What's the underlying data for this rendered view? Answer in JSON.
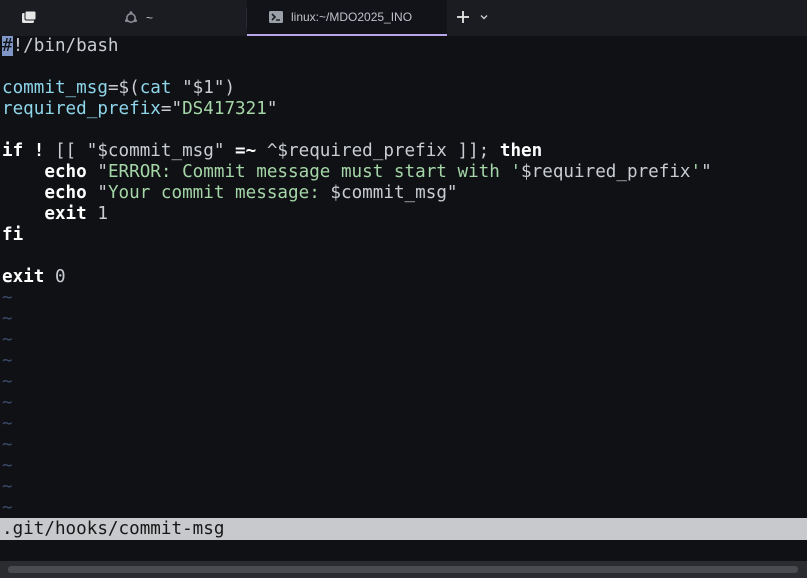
{
  "tabs": [
    {
      "label": "~",
      "icon": "ubuntu-icon"
    },
    {
      "label": "linux:~/MDO2025_INO",
      "icon": "terminal-icon"
    }
  ],
  "editor": {
    "lines": [
      {
        "segments": [
          {
            "t": "#",
            "c": "cursor"
          },
          {
            "t": "!/bin/bash",
            "c": "plain"
          }
        ]
      },
      {
        "segments": []
      },
      {
        "segments": [
          {
            "t": "commit_msg",
            "c": "var"
          },
          {
            "t": "=$(",
            "c": "plain"
          },
          {
            "t": "cat",
            "c": "var"
          },
          {
            "t": " \"$1\")",
            "c": "plain"
          }
        ]
      },
      {
        "segments": [
          {
            "t": "required_prefix",
            "c": "var"
          },
          {
            "t": "=\"",
            "c": "plain"
          },
          {
            "t": "DS417321",
            "c": "str"
          },
          {
            "t": "\"",
            "c": "plain"
          }
        ]
      },
      {
        "segments": []
      },
      {
        "segments": [
          {
            "t": "if",
            "c": "kw"
          },
          {
            "t": " ",
            "c": "plain"
          },
          {
            "t": "!",
            "c": "kw"
          },
          {
            "t": " [[ \"$commit_msg\" ",
            "c": "plain"
          },
          {
            "t": "=~",
            "c": "kw"
          },
          {
            "t": " ^$required_prefix ]]; ",
            "c": "plain"
          },
          {
            "t": "then",
            "c": "kw"
          }
        ]
      },
      {
        "segments": [
          {
            "t": "    ",
            "c": "plain"
          },
          {
            "t": "echo",
            "c": "kw"
          },
          {
            "t": " \"",
            "c": "plain"
          },
          {
            "t": "ERROR: Commit message must start with '",
            "c": "str"
          },
          {
            "t": "$required_prefix",
            "c": "plain"
          },
          {
            "t": "'",
            "c": "str"
          },
          {
            "t": "\"",
            "c": "plain"
          }
        ]
      },
      {
        "segments": [
          {
            "t": "    ",
            "c": "plain"
          },
          {
            "t": "echo",
            "c": "kw"
          },
          {
            "t": " \"",
            "c": "plain"
          },
          {
            "t": "Your commit message: ",
            "c": "str"
          },
          {
            "t": "$commit_msg",
            "c": "plain"
          },
          {
            "t": "\"",
            "c": "plain"
          }
        ]
      },
      {
        "segments": [
          {
            "t": "    ",
            "c": "plain"
          },
          {
            "t": "exit",
            "c": "kw"
          },
          {
            "t": " 1",
            "c": "plain"
          }
        ]
      },
      {
        "segments": [
          {
            "t": "fi",
            "c": "kw"
          }
        ]
      },
      {
        "segments": []
      },
      {
        "segments": [
          {
            "t": "exit",
            "c": "kw"
          },
          {
            "t": " 0",
            "c": "plain"
          }
        ]
      }
    ],
    "tilde_char": "~",
    "tilde_count": 11
  },
  "status": {
    "filename": ".git/hooks/commit-msg"
  },
  "colors": {
    "background": "#0f1115",
    "keyword": "#ffffff",
    "variable": "#8fd6ea",
    "string": "#a5d6a7",
    "tilde": "#3c4a6a",
    "statusbar": "#c8c9cc",
    "tab_accent": "#b7a7ea"
  }
}
